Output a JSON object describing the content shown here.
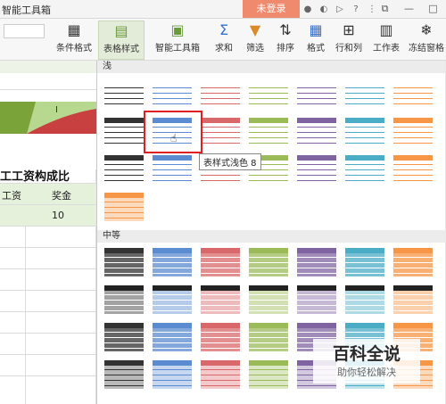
{
  "titlebar": {
    "app_title": "智能工具箱",
    "login_label": "未登录",
    "icons": [
      "skin-icon",
      "dark-icon",
      "share-icon",
      "help-icon",
      "more-icon"
    ],
    "window_controls": [
      "restore-icon",
      "minimize-icon",
      "maximize-icon"
    ]
  },
  "ribbon": {
    "buttons": [
      {
        "label": "条件格式",
        "icon": "conditional-format-icon"
      },
      {
        "label": "表格样式",
        "icon": "table-style-icon"
      },
      {
        "label": "智能工具箱",
        "icon": "toolbox-icon"
      },
      {
        "label": "求和",
        "icon": "sum-icon"
      },
      {
        "label": "筛选",
        "icon": "filter-icon"
      },
      {
        "label": "排序",
        "icon": "sort-icon"
      },
      {
        "label": "格式",
        "icon": "format-icon"
      },
      {
        "label": "行和列",
        "icon": "rows-cols-icon"
      },
      {
        "label": "工作表",
        "icon": "worksheet-icon"
      },
      {
        "label": "冻结窗格",
        "icon": "freeze-icon"
      }
    ]
  },
  "sheet": {
    "chart_label": "I",
    "title": "工工资构成比",
    "header_left": "工资",
    "header_right": "奖金",
    "value": "10"
  },
  "gallery": {
    "section_light": "浅",
    "section_medium": "中等",
    "tooltip": "表样式浅色 8"
  },
  "watermark": {
    "title": "百科全说",
    "subtitle": "助你轻松解决"
  },
  "colors": {
    "black": "#333333",
    "blue": "#5b8bd0",
    "red": "#d9686a",
    "green": "#9bbb59",
    "purple": "#8064a2",
    "teal": "#4bacc6",
    "orange": "#f79646"
  }
}
